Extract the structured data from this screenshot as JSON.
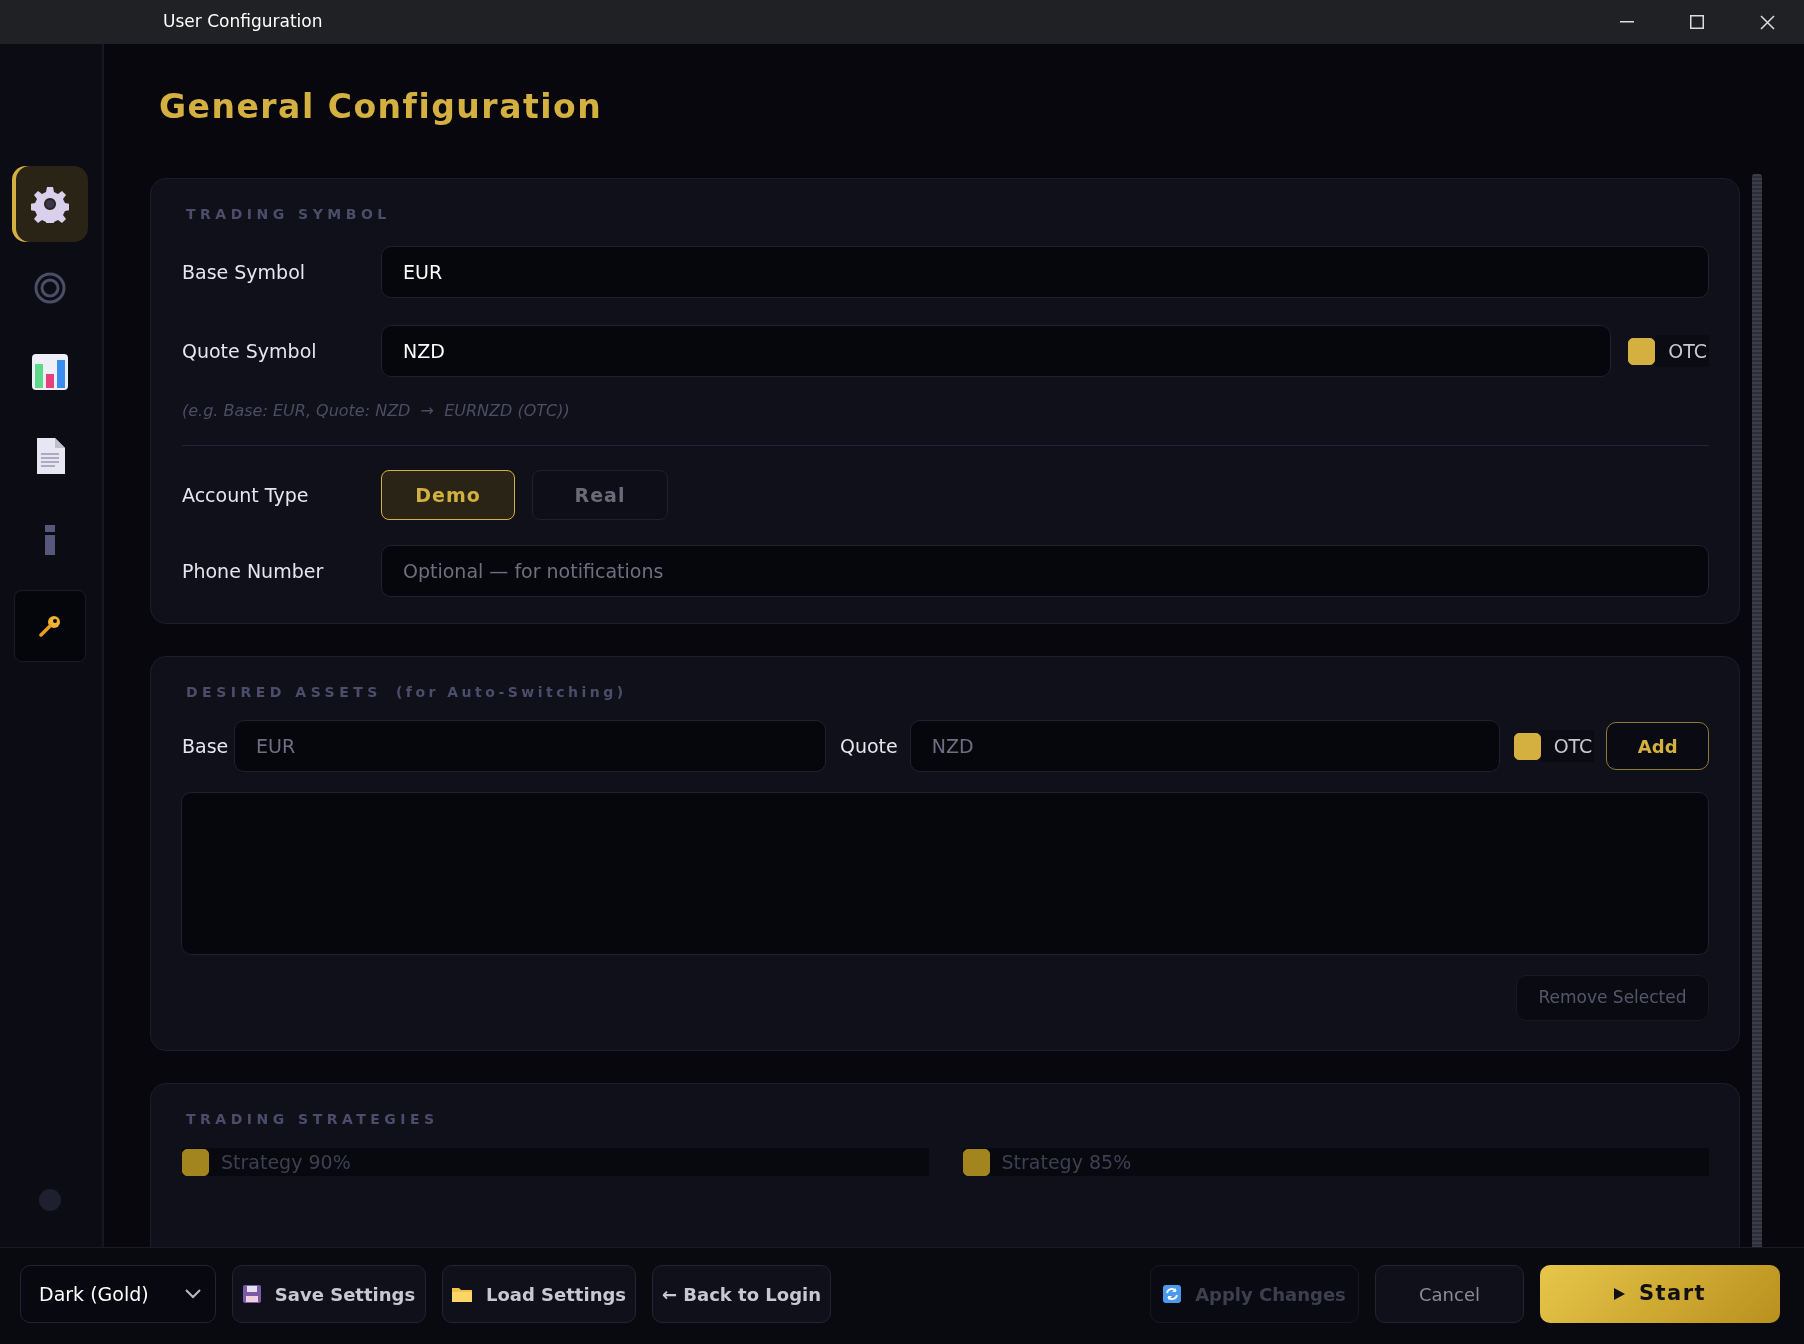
{
  "window": {
    "title": "User Configuration"
  },
  "sidebar": {
    "items": [
      {
        "selected": true
      },
      {
        "selected": false
      },
      {
        "selected": false
      },
      {
        "selected": false
      },
      {
        "selected": false
      },
      {
        "selected": false
      }
    ]
  },
  "page_title": "General Configuration",
  "trading_symbol": {
    "heading": "TRADING SYMBOL",
    "base_label": "Base Symbol",
    "base_value": "EUR",
    "quote_label": "Quote Symbol",
    "quote_value": "NZD",
    "otc": {
      "label": "OTC",
      "checked": true
    },
    "hint": "(e.g. Base: EUR, Quote: NZD  →  EURNZD (OTC))",
    "account_label": "Account Type",
    "account_options": [
      {
        "label": "Demo",
        "selected": true
      },
      {
        "label": "Real",
        "selected": false
      }
    ],
    "phone_label": "Phone Number",
    "phone_placeholder": "Optional — for notifications"
  },
  "desired_assets": {
    "heading": "DESIRED ASSETS",
    "subheading": "(for Auto-Switching)",
    "base_label": "Base",
    "base_placeholder": "EUR",
    "quote_label": "Quote",
    "quote_placeholder": "NZD",
    "otc": {
      "label": "OTC",
      "checked": true
    },
    "add_button": "Add",
    "remove_button": {
      "label": "Remove Selected",
      "disabled": true
    }
  },
  "trading_strategies": {
    "heading": "TRADING STRATEGIES",
    "items": [
      {
        "label": "Strategy 90%",
        "checked": true,
        "disabled": true
      },
      {
        "label": "Strategy 85%",
        "checked": true,
        "disabled": true
      }
    ]
  },
  "footer": {
    "theme": "Dark (Gold)",
    "buttons": [
      {
        "kind": "save",
        "label": "Save Settings",
        "disabled": false
      },
      {
        "kind": "load",
        "label": "Load Settings",
        "disabled": false
      },
      {
        "kind": "back",
        "label": "← Back to Login",
        "disabled": false
      }
    ],
    "right_buttons": [
      {
        "kind": "apply",
        "label": "Apply Changes",
        "disabled": true
      },
      {
        "kind": "cancel",
        "label": "Cancel",
        "disabled": false
      },
      {
        "kind": "start",
        "label": "Start",
        "disabled": false
      }
    ]
  }
}
